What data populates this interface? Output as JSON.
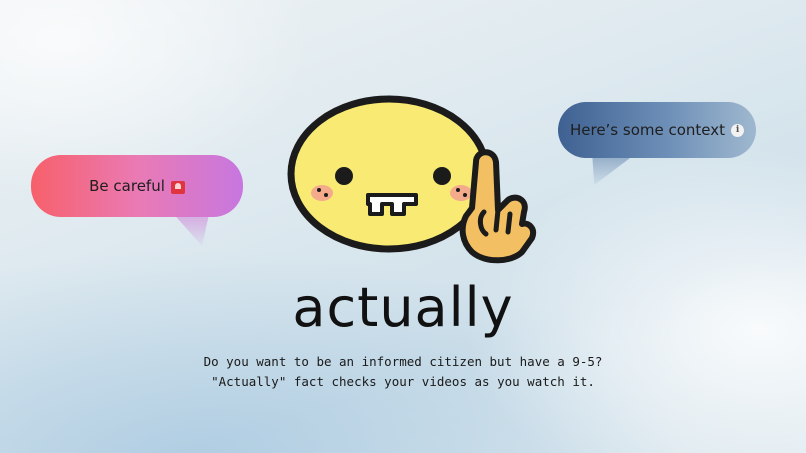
{
  "bubbles": {
    "warning": {
      "label": "Be careful",
      "icon": "siren-icon"
    },
    "context": {
      "label": "Here’s some context",
      "icon": "info-icon",
      "icon_glyph": "i"
    }
  },
  "mascot": {
    "icon": "smiley-pointing-finger-icon"
  },
  "app": {
    "name": "actually"
  },
  "tagline": {
    "line1": "Do you want to be an informed citizen but have a 9-5?",
    "line2": "\"Actually\" fact checks your videos as you watch it."
  },
  "colors": {
    "warning_gradient": [
      "#f7606a",
      "#c777e0"
    ],
    "context_gradient": [
      "#3e6192",
      "#9fb8cf"
    ],
    "mascot_face": "#f8ea73",
    "mascot_hand": "#f2c062"
  }
}
